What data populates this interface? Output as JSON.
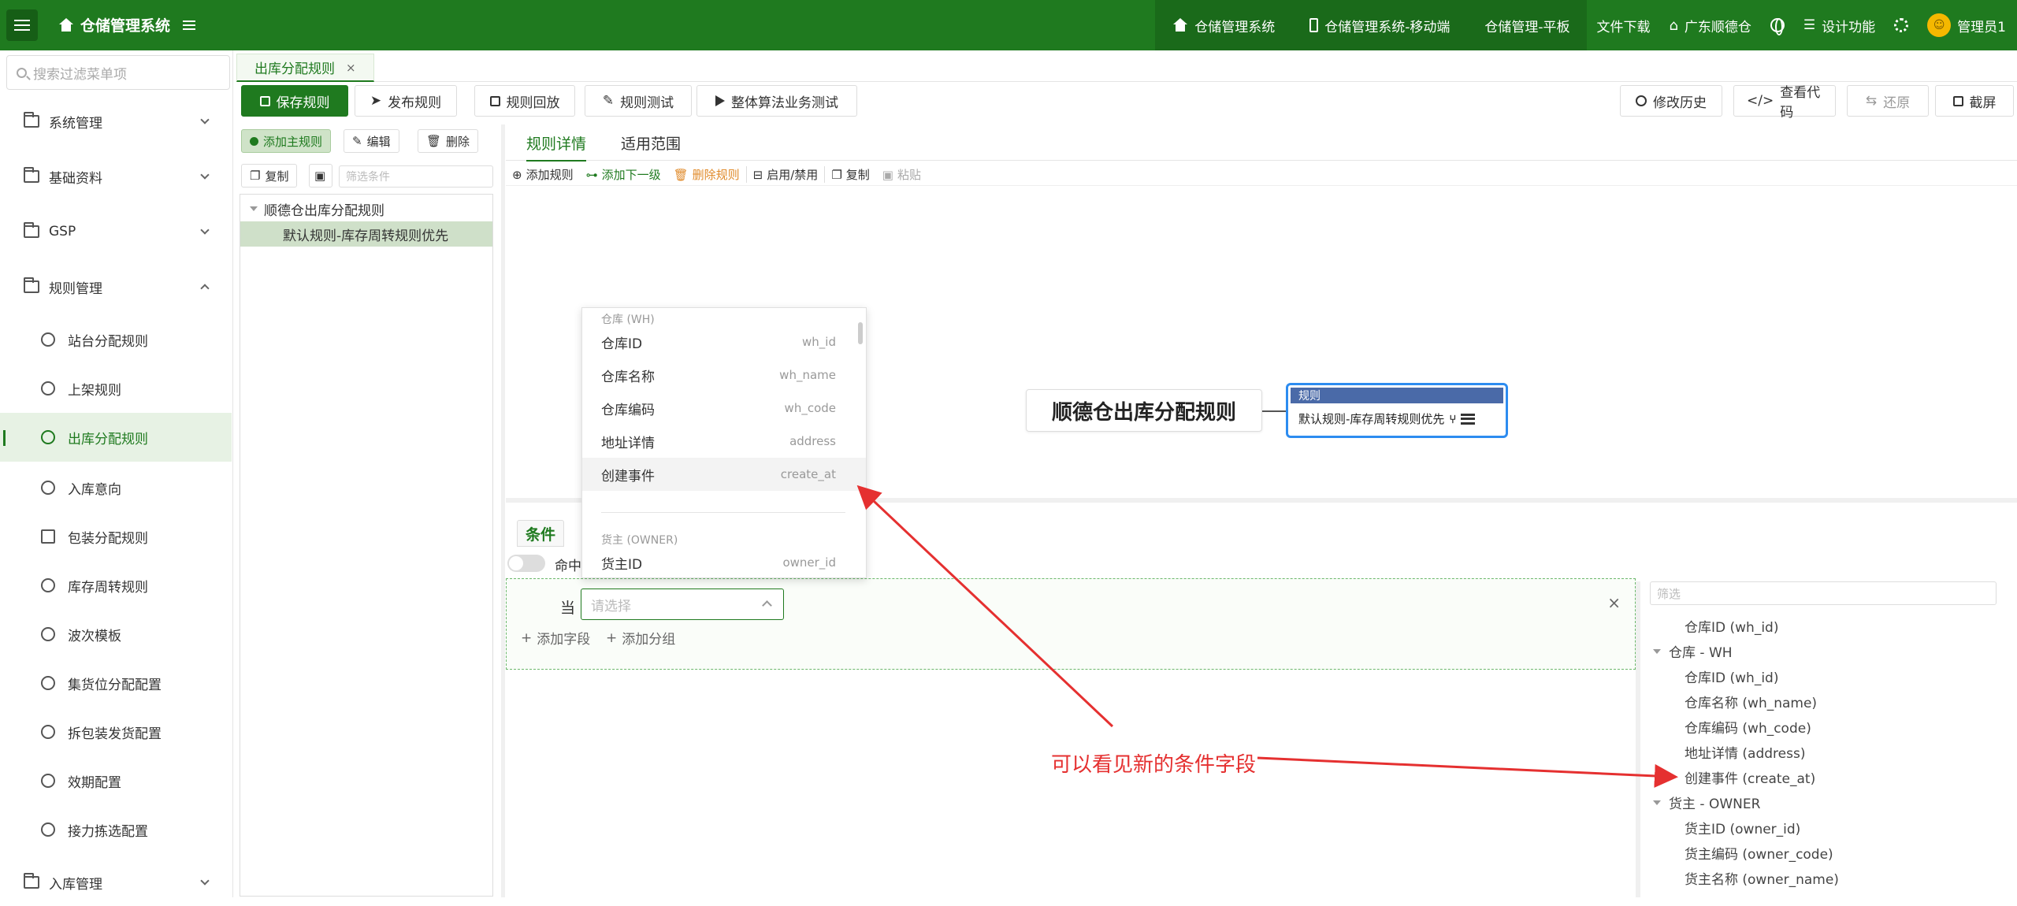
{
  "app": {
    "title": "仓储管理系统",
    "nav": [
      "仓储管理系统",
      "仓储管理系统-移动端",
      "仓储管理-平板",
      "文件下载",
      "广东顺德仓",
      "设计功能",
      "管理员1"
    ],
    "accent": "#1f7a1f"
  },
  "sidebar": {
    "search_placeholder": "搜索过滤菜单项",
    "groups": [
      "系统管理",
      "基础资料",
      "GSP",
      "规则管理",
      "入库管理"
    ],
    "rule_items": [
      "站台分配规则",
      "上架规则",
      "出库分配规则",
      "入库意向",
      "包装分配规则",
      "库存周转规则",
      "波次模板",
      "集货位分配配置",
      "拆包装发货配置",
      "效期配置",
      "接力拣选配置"
    ]
  },
  "tab": {
    "label": "出库分配规则",
    "close": "×"
  },
  "toolbar": {
    "save": "保存规则",
    "publish": "发布规则",
    "playback": "规则回放",
    "test": "规则测试",
    "algo_test": "整体算法业务测试",
    "history": "修改历史",
    "view_code": "查看代码",
    "restore": "还原",
    "screenshot": "截屏"
  },
  "left_panel": {
    "add_main": "添加主规则",
    "edit": "编辑",
    "delete": "删除",
    "copy": "复制",
    "filter_placeholder": "筛选条件",
    "tree_root": "顺德仓出库分配规则",
    "tree_child": "默认规则-库存周转规则优先"
  },
  "right_panel": {
    "tabs": [
      "规则详情",
      "适用范围"
    ],
    "mini_tools": [
      "添加规则",
      "添加下一级",
      "删除规则",
      "启用/禁用",
      "复制",
      "粘贴"
    ],
    "root_node": "顺德仓出库分配规则",
    "rule_node_head": "规则",
    "rule_node_body": "默认规则-库存周转规则优先"
  },
  "condition": {
    "tab": "条件",
    "toggle_label": "命中",
    "when": "当",
    "select_placeholder": "请选择",
    "add_field": "添加字段",
    "add_group": "添加分组",
    "close": "×"
  },
  "dropdown": {
    "group1": "仓库 (WH)",
    "items": [
      {
        "label": "仓库ID",
        "code": "wh_id"
      },
      {
        "label": "仓库名称",
        "code": "wh_name"
      },
      {
        "label": "仓库编码",
        "code": "wh_code"
      },
      {
        "label": "地址详情",
        "code": "address"
      },
      {
        "label": "创建事件",
        "code": "create_at"
      }
    ],
    "group2": "货主 (OWNER)",
    "items2": [
      {
        "label": "货主ID",
        "code": "owner_id"
      }
    ]
  },
  "field_panel": {
    "filter_placeholder": "筛选",
    "top_item": "仓库ID (wh_id)",
    "group_wh": "仓库 - WH",
    "wh_items": [
      "仓库ID (wh_id)",
      "仓库名称 (wh_name)",
      "仓库编码 (wh_code)",
      "地址详情 (address)",
      "创建事件 (create_at)"
    ],
    "group_owner": "货主 - OWNER",
    "owner_items": [
      "货主ID (owner_id)",
      "货主编码 (owner_code)",
      "货主名称 (owner_name)"
    ]
  },
  "annotation": {
    "text": "可以看见新的条件字段",
    "color": "#e53030"
  }
}
